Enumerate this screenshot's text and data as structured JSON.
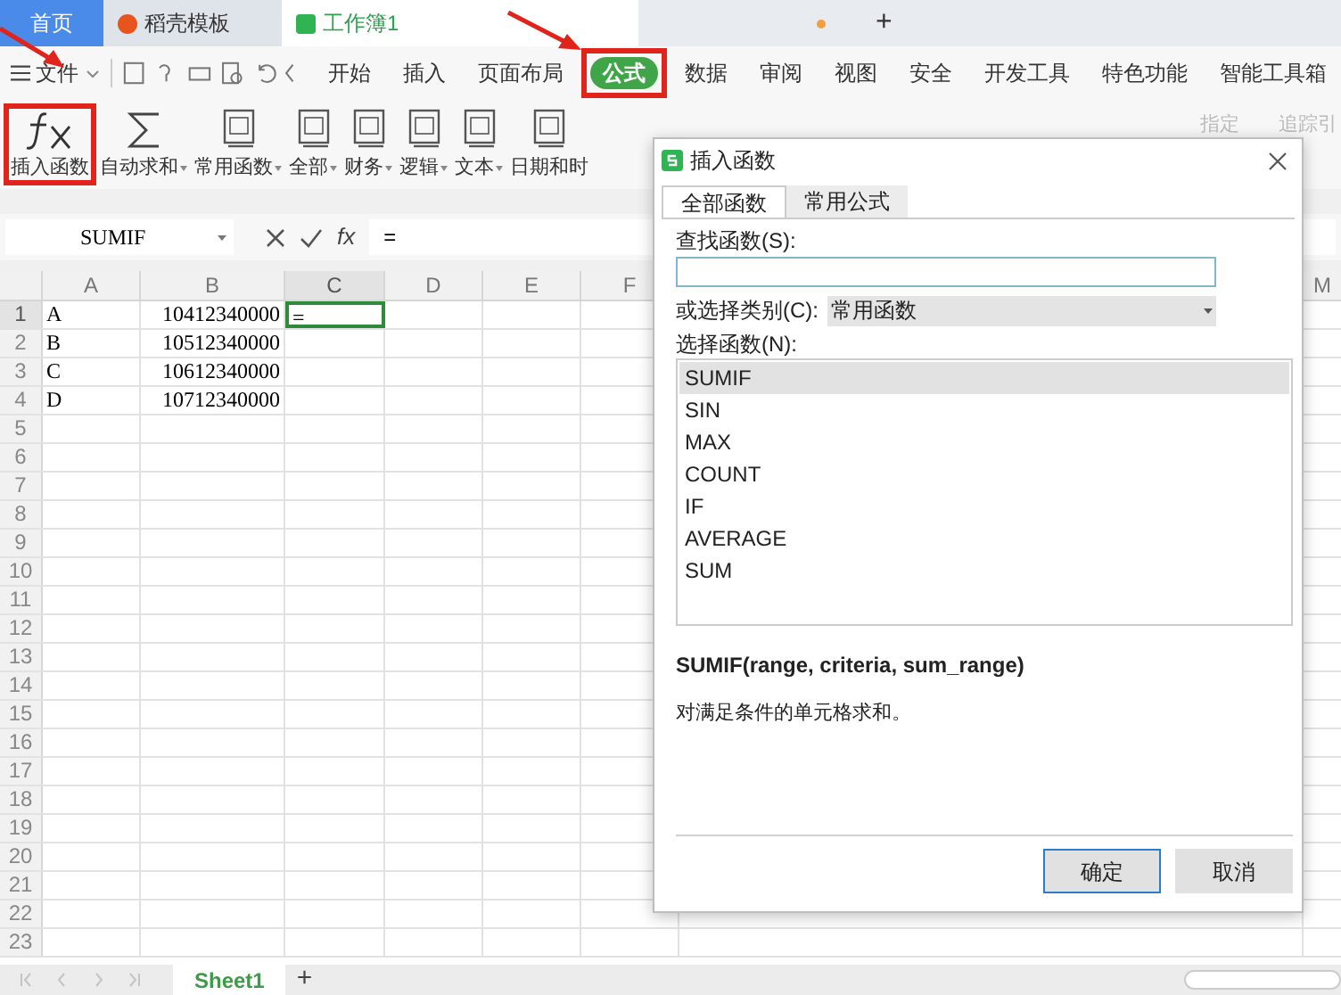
{
  "app_tabs": [
    {
      "label": "首页",
      "kind": "home",
      "selected": false
    },
    {
      "label": "稻壳模板",
      "kind": "docer",
      "selected": false
    },
    {
      "label": "工作簿1",
      "kind": "sheet",
      "selected": true
    }
  ],
  "new_tab": "+",
  "menu": {
    "file": "文件",
    "items": [
      {
        "label": "开始",
        "selected": false,
        "highlighted": false
      },
      {
        "label": "插入",
        "selected": false,
        "highlighted": false
      },
      {
        "label": "页面布局",
        "selected": false,
        "highlighted": false
      },
      {
        "label": "公式",
        "selected": true,
        "highlighted": true
      },
      {
        "label": "数据",
        "selected": false,
        "highlighted": false
      },
      {
        "label": "审阅",
        "selected": false,
        "highlighted": false
      },
      {
        "label": "视图",
        "selected": false,
        "highlighted": false
      },
      {
        "label": "安全",
        "selected": false,
        "highlighted": false
      },
      {
        "label": "开发工具",
        "selected": false,
        "highlighted": false
      },
      {
        "label": "特色功能",
        "selected": false,
        "highlighted": false
      },
      {
        "label": "智能工具箱",
        "selected": false,
        "highlighted": false
      }
    ]
  },
  "ribbon": [
    {
      "label": "插入函数",
      "kind": "large",
      "highlighted": true
    },
    {
      "label": "自动求和",
      "kind": "sum",
      "highlighted": false,
      "dropdown": true
    },
    {
      "label": "常用函数",
      "kind": "book",
      "highlighted": false,
      "dropdown": true
    },
    {
      "label": "全部",
      "kind": "book",
      "highlighted": false,
      "dropdown": true
    },
    {
      "label": "财务",
      "kind": "book",
      "highlighted": false,
      "dropdown": true
    },
    {
      "label": "逻辑",
      "kind": "book",
      "highlighted": false,
      "dropdown": true
    },
    {
      "label": "文本",
      "kind": "book",
      "highlighted": false,
      "dropdown": true
    },
    {
      "label": "日期和时",
      "kind": "book",
      "highlighted": false
    }
  ],
  "ribbon_right": [
    {
      "label": "指定",
      "disabled": true
    },
    {
      "label": "追踪引",
      "disabled": true
    }
  ],
  "formula_bar": {
    "name_box": "SUMIF",
    "fx": "fx",
    "value": "="
  },
  "sheet": {
    "columns": [
      "A",
      "B",
      "C",
      "D",
      "E",
      "F"
    ],
    "far_column": "M",
    "rows": [
      {
        "n": "1",
        "cells": [
          {
            "text": "A",
            "selected": false
          },
          {
            "text": "10412340000",
            "selected": false
          },
          {
            "text": "=",
            "selected": true
          }
        ]
      },
      {
        "n": "2",
        "cells": [
          {
            "text": "B",
            "selected": false
          },
          {
            "text": "10512340000",
            "selected": false
          }
        ]
      },
      {
        "n": "3",
        "cells": [
          {
            "text": "C",
            "selected": false
          },
          {
            "text": "10612340000",
            "selected": false
          }
        ]
      },
      {
        "n": "4",
        "cells": [
          {
            "text": "D",
            "selected": false
          },
          {
            "text": "10712340000",
            "selected": false
          }
        ]
      },
      {
        "n": "5"
      },
      {
        "n": "6"
      },
      {
        "n": "7"
      },
      {
        "n": "8"
      },
      {
        "n": "9"
      },
      {
        "n": "10"
      },
      {
        "n": "11"
      },
      {
        "n": "12"
      },
      {
        "n": "13"
      },
      {
        "n": "14"
      },
      {
        "n": "15"
      },
      {
        "n": "16"
      },
      {
        "n": "17"
      },
      {
        "n": "18"
      },
      {
        "n": "19"
      },
      {
        "n": "20"
      },
      {
        "n": "21"
      },
      {
        "n": "22"
      },
      {
        "n": "23"
      }
    ]
  },
  "sheet_tabs": [
    {
      "label": "Sheet1",
      "selected": true
    }
  ],
  "add_sheet": "+",
  "dialog": {
    "title": "插入函数",
    "tabs": [
      {
        "label": "全部函数",
        "selected": true
      },
      {
        "label": "常用公式",
        "selected": false
      }
    ],
    "search_label": "查找函数(S):",
    "category_label": "或选择类别(C):",
    "category": "常用函数",
    "list_label": "选择函数(N):",
    "functions": [
      {
        "name": "SUMIF",
        "selected": true
      },
      {
        "name": "SIN",
        "selected": false
      },
      {
        "name": "MAX",
        "selected": false
      },
      {
        "name": "COUNT",
        "selected": false
      },
      {
        "name": "IF",
        "selected": false
      },
      {
        "name": "AVERAGE",
        "selected": false
      },
      {
        "name": "SUM",
        "selected": false
      }
    ],
    "signature": "SUMIF(range, criteria, sum_range)",
    "description": "对满足条件的单元格求和。",
    "buttons": [
      {
        "label": "确定",
        "kind": "primary"
      },
      {
        "label": "取消",
        "kind": "secondary"
      }
    ]
  }
}
